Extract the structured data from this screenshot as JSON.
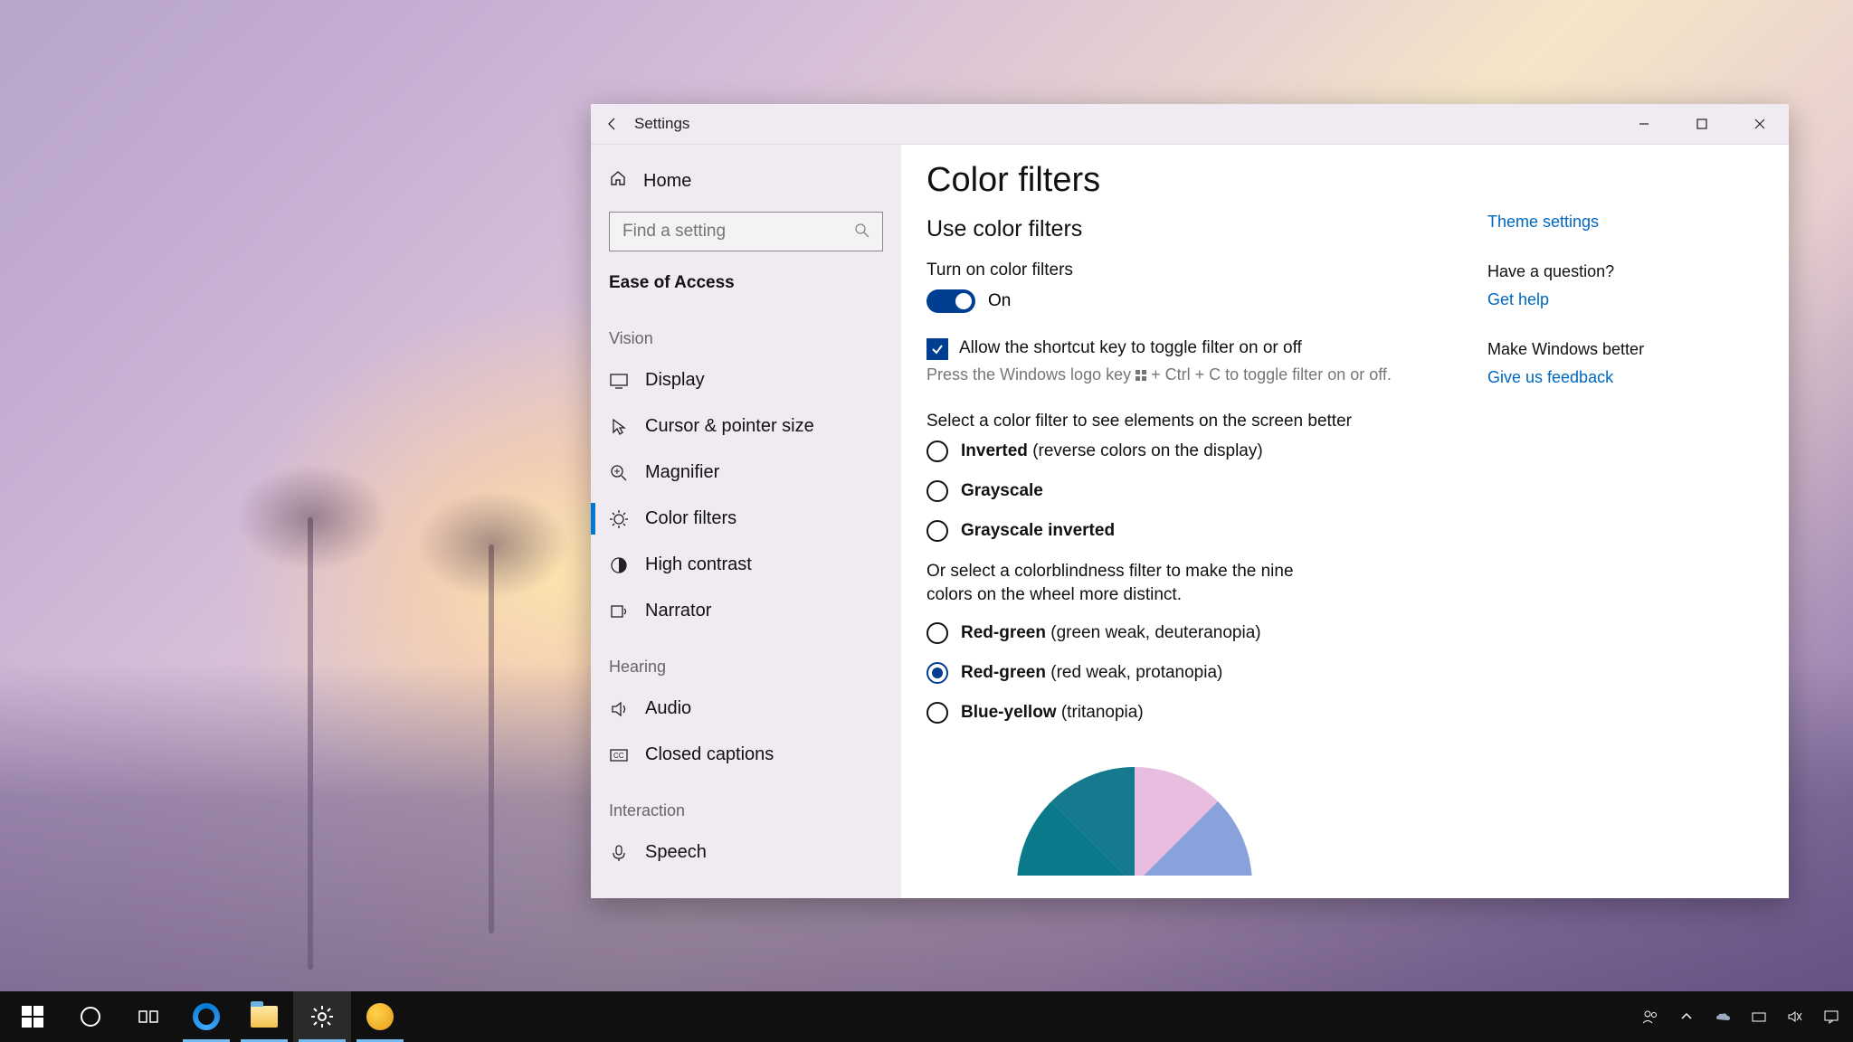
{
  "window": {
    "title": "Settings"
  },
  "sidebar": {
    "home": "Home",
    "search_placeholder": "Find a setting",
    "section": "Ease of Access",
    "groups": [
      {
        "label": "Vision",
        "items": [
          "Display",
          "Cursor & pointer size",
          "Magnifier",
          "Color filters",
          "High contrast",
          "Narrator"
        ],
        "active_index": 3
      },
      {
        "label": "Hearing",
        "items": [
          "Audio",
          "Closed captions"
        ]
      },
      {
        "label": "Interaction",
        "items": [
          "Speech"
        ]
      }
    ]
  },
  "page": {
    "title": "Color filters",
    "subhead": "Use color filters",
    "toggle_title": "Turn on color filters",
    "toggle_state": "On",
    "shortcut_label": "Allow the shortcut key to toggle filter on or off",
    "shortcut_hint_pre": "Press the Windows logo key",
    "shortcut_hint_post": "+ Ctrl + C to toggle filter on or off.",
    "select_label": "Select a color filter to see elements on the screen better",
    "filters": [
      {
        "bold": "Inverted",
        "desc": " (reverse colors on the display)"
      },
      {
        "bold": "Grayscale",
        "desc": ""
      },
      {
        "bold": "Grayscale inverted",
        "desc": ""
      }
    ],
    "cb_label": "Or select a colorblindness filter to make the nine colors on the wheel more distinct.",
    "cb_filters": [
      {
        "bold": "Red-green",
        "desc": " (green weak, deuteranopia)"
      },
      {
        "bold": "Red-green",
        "desc": " (red weak, protanopia)"
      },
      {
        "bold": "Blue-yellow",
        "desc": " (tritanopia)"
      }
    ],
    "cb_selected_index": 1
  },
  "rail": {
    "theme_link": "Theme settings",
    "question_hdr": "Have a question?",
    "help_link": "Get help",
    "better_hdr": "Make Windows better",
    "feedback_link": "Give us feedback"
  }
}
